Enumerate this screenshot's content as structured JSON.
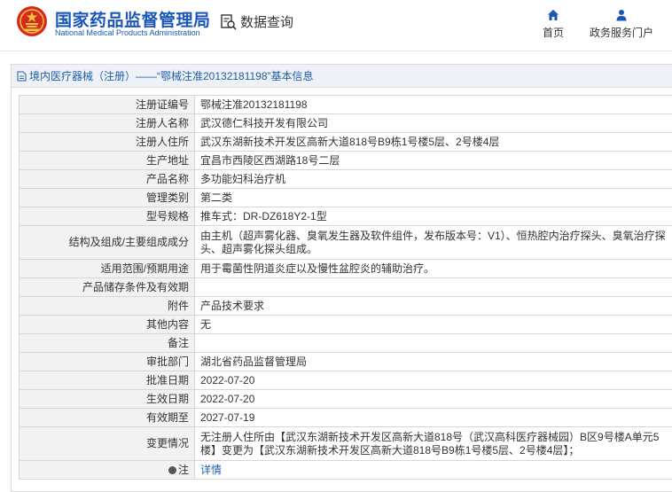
{
  "header": {
    "brand_cn": "国家药品监督管理局",
    "brand_en": "National Medical Products Administration",
    "query_label": "数据查询",
    "nav": [
      {
        "label": "首页",
        "icon": "home-icon"
      },
      {
        "label": "政务服务门户",
        "icon": "user-icon"
      }
    ]
  },
  "panel": {
    "title": "境内医疗器械（注册）——“鄂械注准20132181198”基本信息"
  },
  "rows": [
    {
      "label": "注册证编号",
      "value": "鄂械注准20132181198"
    },
    {
      "label": "注册人名称",
      "value": "武汉德仁科技开发有限公司"
    },
    {
      "label": "注册人住所",
      "value": "武汉东湖新技术开发区高新大道818号B9栋1号楼5层、2号楼4层"
    },
    {
      "label": "生产地址",
      "value": "宜昌市西陵区西湖路18号二层"
    },
    {
      "label": "产品名称",
      "value": "多功能妇科治疗机"
    },
    {
      "label": "管理类别",
      "value": "第二类"
    },
    {
      "label": "型号规格",
      "value": "推车式：DR-DZ618Y2-1型"
    },
    {
      "label": "结构及组成/主要组成成分",
      "value": "由主机（超声雾化器、臭氧发生器及软件组件，发布版本号：V1）、恒热腔内治疗探头、臭氧治疗探头、超声雾化探头组成。"
    },
    {
      "label": "适用范围/预期用途",
      "value": "用于霉菌性阴道炎症以及慢性盆腔炎的辅助治疗。"
    },
    {
      "label": "产品储存条件及有效期",
      "value": ""
    },
    {
      "label": "附件",
      "value": "产品技术要求"
    },
    {
      "label": "其他内容",
      "value": "无"
    },
    {
      "label": "备注",
      "value": ""
    },
    {
      "label": "审批部门",
      "value": "湖北省药品监督管理局"
    },
    {
      "label": "批准日期",
      "value": "2022-07-20"
    },
    {
      "label": "生效日期",
      "value": "2022-07-20"
    },
    {
      "label": "有效期至",
      "value": "2027-07-19"
    },
    {
      "label": "变更情况",
      "value": "无注册人住所由【武汉东湖新技术开发区高新大道818号（武汉高科医疗器械园）B区9号楼A单元5楼】变更为【武汉东湖新技术开发区高新大道818号B9栋1号楼5层、2号楼4层】；"
    }
  ],
  "note": {
    "label": "注",
    "link_text": "详情",
    "icon": "note-dot-icon"
  },
  "colors": {
    "brand_blue": "#1a56b8",
    "link_blue": "#1d5fa8",
    "label_bg": "#f2f2f2",
    "title_bg": "#eef1f6"
  }
}
